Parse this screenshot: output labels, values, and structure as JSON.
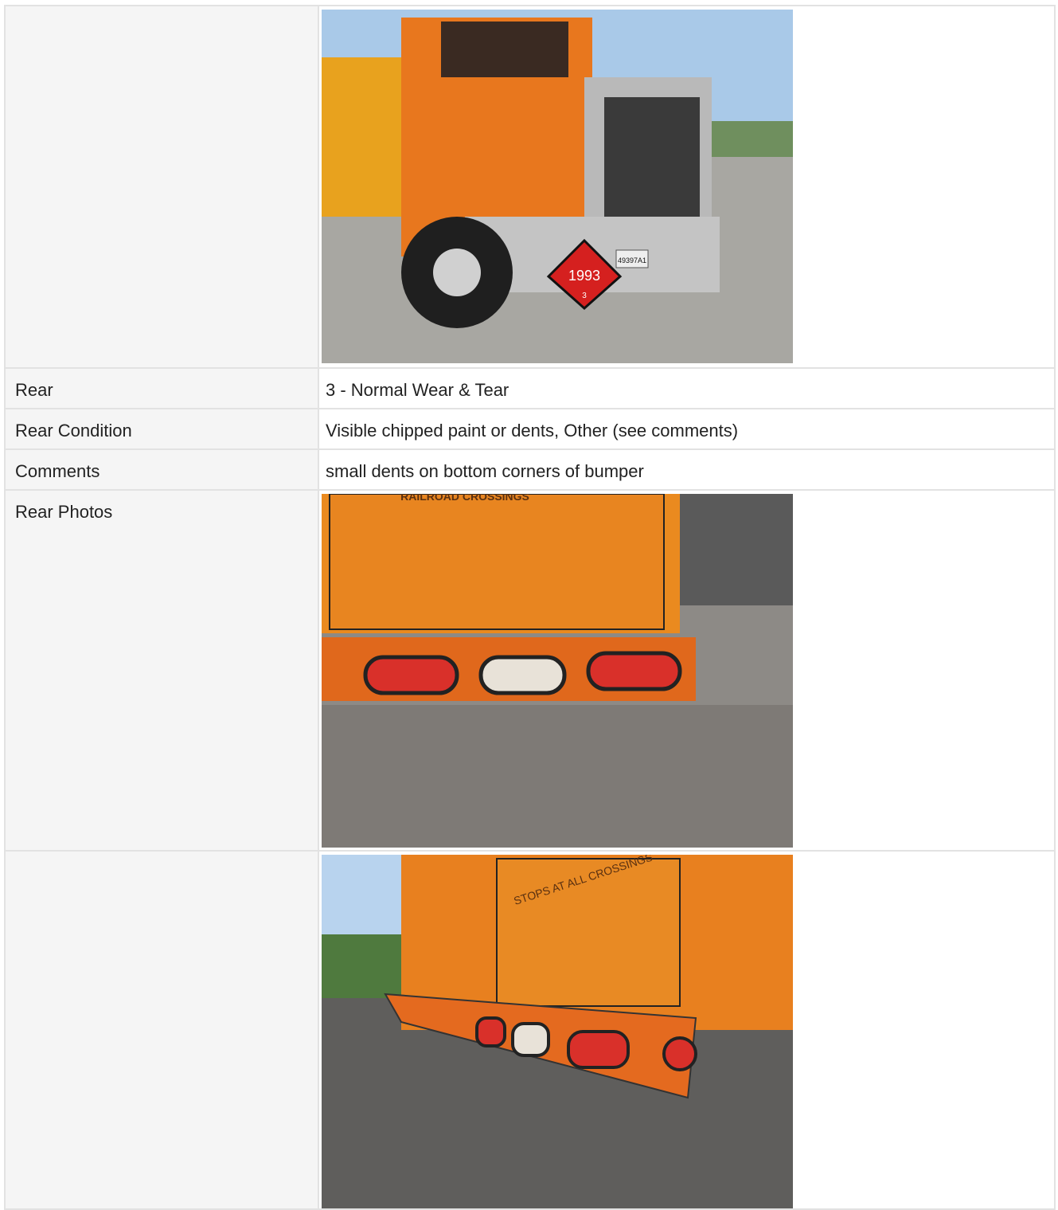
{
  "rows": [
    {
      "label": "",
      "type": "photo",
      "photo": "front-truck-photo"
    },
    {
      "label": "Rear",
      "value": "3 - Normal Wear & Tear"
    },
    {
      "label": "Rear Condition",
      "value": "Visible chipped paint or dents, Other (see comments)"
    },
    {
      "label": "Comments",
      "value": "small dents on bottom corners of bumper"
    },
    {
      "label": "Rear Photos",
      "type": "photo",
      "photo": "rear-bumper-photo-1"
    },
    {
      "label": "",
      "type": "photo",
      "photo": "rear-bumper-photo-2"
    }
  ],
  "photo_text": {
    "placard_number": "1993",
    "placard_class": "3",
    "plate": "49397A1",
    "rear_sign_1": "RAILROAD CROSSINGS",
    "rear_sign_2": "STOPS AT ALL CROSSINGS"
  },
  "colors": {
    "truck_orange": "#e8771e",
    "border": "#e2e2e2",
    "label_bg": "#f5f5f5"
  }
}
